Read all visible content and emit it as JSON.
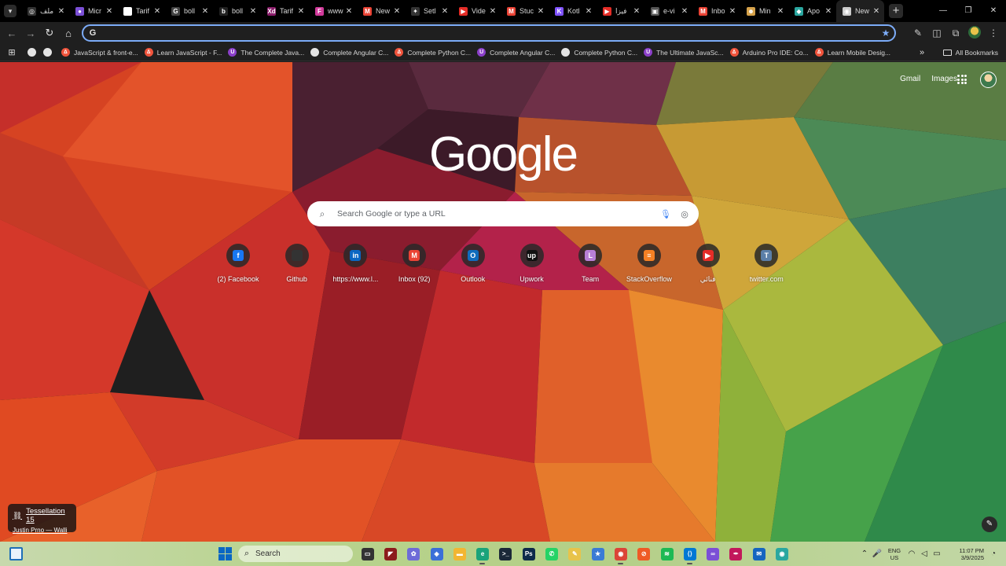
{
  "browser": {
    "tabs": [
      {
        "title": "ملف",
        "favicon_color": "#333333",
        "glyph": "◎"
      },
      {
        "title": "Micr",
        "favicon_color": "#7b4fd6",
        "glyph": "●"
      },
      {
        "title": "Tarif",
        "favicon_color": "#ffffff",
        "glyph": "N"
      },
      {
        "title": "boll",
        "favicon_color": "#444444",
        "glyph": "G"
      },
      {
        "title": "boll",
        "favicon_color": "#222222",
        "glyph": "b"
      },
      {
        "title": "Tarif",
        "favicon_color": "#8b1d6b",
        "glyph": "Xd"
      },
      {
        "title": "www",
        "favicon_color": "#d23a9b",
        "glyph": "F"
      },
      {
        "title": "New",
        "favicon_color": "#ea4335",
        "glyph": "M"
      },
      {
        "title": "Setl",
        "favicon_color": "#333333",
        "glyph": "✦"
      },
      {
        "title": "Vide",
        "favicon_color": "#e52d27",
        "glyph": "▶"
      },
      {
        "title": "Stuc",
        "favicon_color": "#ea4335",
        "glyph": "M"
      },
      {
        "title": "Kotl",
        "favicon_color": "#7f52ff",
        "glyph": "K"
      },
      {
        "title": "فيزا",
        "favicon_color": "#e52d27",
        "glyph": "▶"
      },
      {
        "title": "e-vi",
        "favicon_color": "#555555",
        "glyph": "▣"
      },
      {
        "title": "Inbo",
        "favicon_color": "#ea4335",
        "glyph": "M"
      },
      {
        "title": "Min",
        "favicon_color": "#d6a24a",
        "glyph": "☻"
      },
      {
        "title": "Apo",
        "favicon_color": "#2aa7a0",
        "glyph": "◆"
      },
      {
        "title": "New",
        "favicon_color": "#cccccc",
        "glyph": "◉",
        "active": true
      }
    ],
    "omnibox": {
      "value": "",
      "placeholder": ""
    },
    "bookmarks": [
      {
        "label": "JavaScript & front-e...",
        "color": "#f0543c",
        "glyph": "∆"
      },
      {
        "label": "Learn JavaScript - F...",
        "color": "#f0543c",
        "glyph": "∆"
      },
      {
        "label": "The Complete Java...",
        "color": "#8b3fc9",
        "glyph": "U"
      },
      {
        "label": "Complete Angular C...",
        "color": "#e3e3e3",
        "glyph": ""
      },
      {
        "label": "Complete Python C...",
        "color": "#f0543c",
        "glyph": "∆"
      },
      {
        "label": "Complete Angular C...",
        "color": "#8b3fc9",
        "glyph": "U"
      },
      {
        "label": "Complete Python C...",
        "color": "#e3e3e3",
        "glyph": ""
      },
      {
        "label": "The Ultimate JavaSc...",
        "color": "#8b3fc9",
        "glyph": "U"
      },
      {
        "label": "Arduino Pro IDE: Co...",
        "color": "#f0543c",
        "glyph": "∆"
      },
      {
        "label": "Learn Mobile Desig...",
        "color": "#f0543c",
        "glyph": "∆"
      }
    ],
    "all_bookmarks_label": "All Bookmarks"
  },
  "ntp": {
    "links": {
      "gmail": "Gmail",
      "images": "Images"
    },
    "logo": "Google",
    "search_placeholder": "Search Google or type a URL",
    "shortcuts": [
      {
        "label": "(2) Facebook",
        "color": "#1877f2",
        "glyph": "f"
      },
      {
        "label": "Github",
        "color": "#333333",
        "glyph": ""
      },
      {
        "label": "https://www.l...",
        "color": "#0a66c2",
        "glyph": "in"
      },
      {
        "label": "Inbox (92)",
        "color": "#ea4335",
        "glyph": "M"
      },
      {
        "label": "Outlook",
        "color": "#0f6cbd",
        "glyph": "O"
      },
      {
        "label": "Upwork",
        "color": "#111111",
        "glyph": "up"
      },
      {
        "label": "Team",
        "color": "#b87fd6",
        "glyph": "L"
      },
      {
        "label": "StackOverflow",
        "color": "#f48024",
        "glyph": "≡"
      },
      {
        "label": "فنائي",
        "color": "#e52d27",
        "glyph": "▶"
      },
      {
        "label": "twitter.com",
        "color": "#5b7fa8",
        "glyph": "T"
      }
    ],
    "attribution": {
      "title": "Tessellation 15",
      "author": "Justin Prno — Walli"
    }
  },
  "taskbar": {
    "search_label": "Search",
    "apps": [
      {
        "name": "task-view",
        "color": "#333333",
        "glyph": "▭"
      },
      {
        "name": "app-red",
        "color": "#8c1c1c",
        "glyph": "◤"
      },
      {
        "name": "copilot",
        "color": "#6d6bd8",
        "glyph": "✿"
      },
      {
        "name": "app-blue",
        "color": "#3b6fd8",
        "glyph": "◈"
      },
      {
        "name": "file-explorer",
        "color": "#f2b632",
        "glyph": "▬"
      },
      {
        "name": "edge",
        "color": "#1aa37a",
        "glyph": "e"
      },
      {
        "name": "terminal",
        "color": "#1b2838",
        "glyph": ">_"
      },
      {
        "name": "photoshop",
        "color": "#0d2a4a",
        "glyph": "Ps"
      },
      {
        "name": "whatsapp",
        "color": "#25d366",
        "glyph": "✆"
      },
      {
        "name": "app-paint",
        "color": "#e8c34a",
        "glyph": "✎"
      },
      {
        "name": "app-star",
        "color": "#3a7bd5",
        "glyph": "★"
      },
      {
        "name": "chrome",
        "color": "#db4437",
        "glyph": "◉"
      },
      {
        "name": "postman",
        "color": "#ef5b25",
        "glyph": "⊘"
      },
      {
        "name": "spotify",
        "color": "#1db954",
        "glyph": "≋"
      },
      {
        "name": "vscode",
        "color": "#0078d4",
        "glyph": "⟨⟩"
      },
      {
        "name": "visual-studio",
        "color": "#7b4fd6",
        "glyph": "∞"
      },
      {
        "name": "app-pen",
        "color": "#c2185b",
        "glyph": "✒"
      },
      {
        "name": "mail",
        "color": "#1565c0",
        "glyph": "✉"
      },
      {
        "name": "app-teal",
        "color": "#2aa7a0",
        "glyph": "◉"
      }
    ],
    "lang": {
      "line1": "ENG",
      "line2": "US"
    },
    "clock": {
      "time": "11:07 PM",
      "date": "3/9/2025"
    }
  }
}
